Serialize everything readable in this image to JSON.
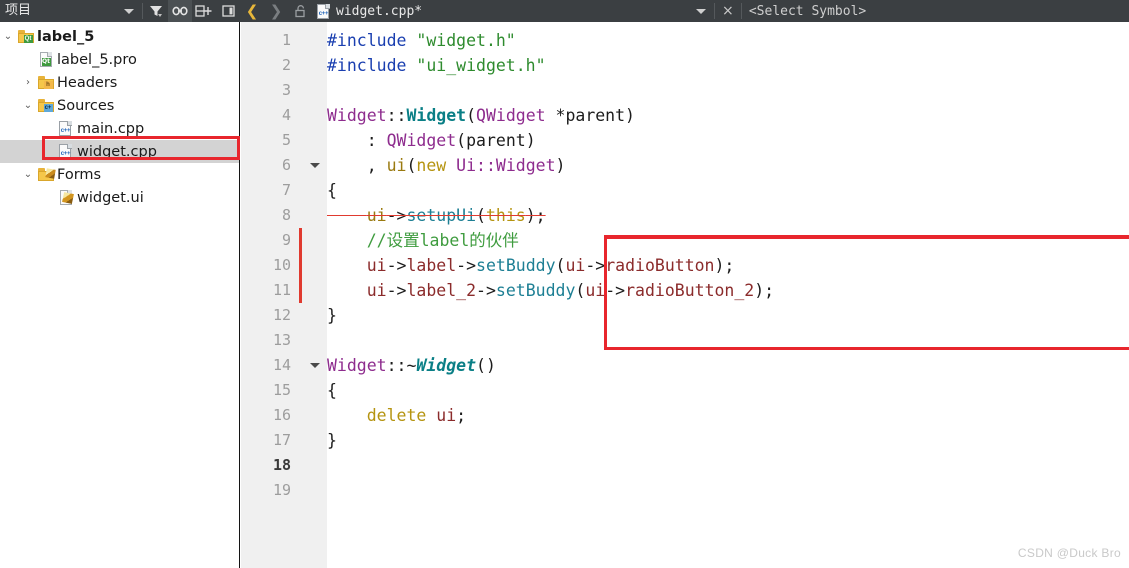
{
  "toolbar": {
    "panel_title": "项目",
    "dropdown_icon": "chevron-down-icon",
    "filter_icon": "filter-icon",
    "link_icon": "link-icon",
    "split_icon": "split-pane-add-icon",
    "sidebar_icon": "sidebar-toggle-icon",
    "back_icon": "back-arrow-icon",
    "forward_icon": "forward-arrow-icon",
    "lock_icon": "unlocked-padlock-icon",
    "file_icon": "cpp-file-icon",
    "file_icon_label": "c++",
    "file_name": "widget.cpp*",
    "file_dropdown_icon": "chevron-down-icon",
    "close_icon": "close-x-icon",
    "close_label": "×",
    "symbol_selector": "<Select Symbol>"
  },
  "tree": {
    "items": [
      {
        "label": "label_5",
        "icon": "qt-project-folder-icon",
        "expander": "⌄",
        "indent": 0,
        "bold": true,
        "selected": false,
        "kind": "folder-qt"
      },
      {
        "label": "label_5.pro",
        "icon": "qt-pro-file-icon",
        "expander": "",
        "indent": 1,
        "bold": false,
        "selected": false,
        "kind": "doc-qt"
      },
      {
        "label": "Headers",
        "icon": "headers-folder-icon",
        "expander": "›",
        "indent": 1,
        "bold": false,
        "selected": false,
        "kind": "folder-h"
      },
      {
        "label": "Sources",
        "icon": "sources-folder-icon",
        "expander": "⌄",
        "indent": 1,
        "bold": false,
        "selected": false,
        "kind": "folder-cpp"
      },
      {
        "label": "main.cpp",
        "icon": "cpp-file-icon",
        "expander": "",
        "indent": 2,
        "bold": false,
        "selected": false,
        "kind": "cppfile"
      },
      {
        "label": "widget.cpp",
        "icon": "cpp-file-icon",
        "expander": "",
        "indent": 2,
        "bold": false,
        "selected": true,
        "kind": "cppfile"
      },
      {
        "label": "Forms",
        "icon": "forms-folder-icon",
        "expander": "⌄",
        "indent": 1,
        "bold": false,
        "selected": false,
        "kind": "folder-ui"
      },
      {
        "label": "widget.ui",
        "icon": "ui-file-icon",
        "expander": "",
        "indent": 2,
        "bold": false,
        "selected": false,
        "kind": "doc-ui"
      }
    ]
  },
  "editor": {
    "current_line": 18,
    "fold_marker_lines": [
      6,
      14
    ],
    "change_bar_lines": [
      9,
      10,
      11
    ],
    "lines": [
      {
        "n": 1,
        "tokens": [
          {
            "t": "#include ",
            "c": "t-pp"
          },
          {
            "t": "\"widget.h\"",
            "c": "t-str"
          }
        ]
      },
      {
        "n": 2,
        "tokens": [
          {
            "t": "#include ",
            "c": "t-pp"
          },
          {
            "t": "\"ui_widget.h\"",
            "c": "t-str"
          }
        ]
      },
      {
        "n": 3,
        "tokens": []
      },
      {
        "n": 4,
        "tokens": [
          {
            "t": "Widget",
            "c": "t-cls"
          },
          {
            "t": "::",
            "c": "t-plain"
          },
          {
            "t": "Widget",
            "c": "t-ctor"
          },
          {
            "t": "(",
            "c": "t-plain"
          },
          {
            "t": "QWidget",
            "c": "t-cls"
          },
          {
            "t": " *parent)",
            "c": "t-plain"
          }
        ]
      },
      {
        "n": 5,
        "tokens": [
          {
            "t": "    : ",
            "c": "t-plain"
          },
          {
            "t": "QWidget",
            "c": "t-cls"
          },
          {
            "t": "(parent)",
            "c": "t-plain"
          }
        ]
      },
      {
        "n": 6,
        "tokens": [
          {
            "t": "    , ",
            "c": "t-plain"
          },
          {
            "t": "ui",
            "c": "t-var"
          },
          {
            "t": "(",
            "c": "t-plain"
          },
          {
            "t": "new",
            "c": "t-kw"
          },
          {
            "t": " ",
            "c": "t-plain"
          },
          {
            "t": "Ui::Widget",
            "c": "t-cls"
          },
          {
            "t": ")",
            "c": "t-plain"
          }
        ]
      },
      {
        "n": 7,
        "tokens": [
          {
            "t": "{",
            "c": "t-plain"
          }
        ]
      },
      {
        "n": 8,
        "tokens": [
          {
            "t": "    ",
            "c": "t-plain"
          },
          {
            "t": "ui",
            "c": "t-var"
          },
          {
            "t": "->",
            "c": "t-plain"
          },
          {
            "t": "setupUi",
            "c": "t-fn"
          },
          {
            "t": "(",
            "c": "t-plain"
          },
          {
            "t": "this",
            "c": "t-kw"
          },
          {
            "t": ");",
            "c": "t-plain"
          }
        ]
      },
      {
        "n": 9,
        "tokens": [
          {
            "t": "    //设置label的伙伴",
            "c": "t-cmt"
          }
        ]
      },
      {
        "n": 10,
        "tokens": [
          {
            "t": "    ",
            "c": "t-plain"
          },
          {
            "t": "ui",
            "c": "t-fld"
          },
          {
            "t": "->",
            "c": "t-plain"
          },
          {
            "t": "label",
            "c": "t-fld"
          },
          {
            "t": "->",
            "c": "t-plain"
          },
          {
            "t": "setBuddy",
            "c": "t-fn"
          },
          {
            "t": "(",
            "c": "t-plain"
          },
          {
            "t": "ui",
            "c": "t-fld"
          },
          {
            "t": "->",
            "c": "t-plain"
          },
          {
            "t": "radioButton",
            "c": "t-fld"
          },
          {
            "t": ");",
            "c": "t-plain"
          }
        ]
      },
      {
        "n": 11,
        "tokens": [
          {
            "t": "    ",
            "c": "t-plain"
          },
          {
            "t": "ui",
            "c": "t-fld"
          },
          {
            "t": "->",
            "c": "t-plain"
          },
          {
            "t": "label_2",
            "c": "t-fld"
          },
          {
            "t": "->",
            "c": "t-plain"
          },
          {
            "t": "setBuddy",
            "c": "t-fn"
          },
          {
            "t": "(",
            "c": "t-plain"
          },
          {
            "t": "ui",
            "c": "t-fld"
          },
          {
            "t": "->",
            "c": "t-plain"
          },
          {
            "t": "radioButton_2",
            "c": "t-fld"
          },
          {
            "t": ");",
            "c": "t-plain"
          }
        ]
      },
      {
        "n": 12,
        "tokens": [
          {
            "t": "}",
            "c": "t-plain"
          }
        ]
      },
      {
        "n": 13,
        "tokens": []
      },
      {
        "n": 14,
        "tokens": [
          {
            "t": "Widget",
            "c": "t-cls"
          },
          {
            "t": "::~",
            "c": "t-plain"
          },
          {
            "t": "Widget",
            "c": "t-dtor"
          },
          {
            "t": "()",
            "c": "t-plain"
          }
        ]
      },
      {
        "n": 15,
        "tokens": [
          {
            "t": "{",
            "c": "t-plain"
          }
        ]
      },
      {
        "n": 16,
        "tokens": [
          {
            "t": "    ",
            "c": "t-plain"
          },
          {
            "t": "delete",
            "c": "t-kw"
          },
          {
            "t": " ",
            "c": "t-plain"
          },
          {
            "t": "ui",
            "c": "t-fld"
          },
          {
            "t": ";",
            "c": "t-plain"
          }
        ]
      },
      {
        "n": 17,
        "tokens": [
          {
            "t": "}",
            "c": "t-plain"
          }
        ]
      },
      {
        "n": 18,
        "tokens": []
      },
      {
        "n": 19,
        "tokens": []
      }
    ]
  },
  "annotations": {
    "tree_highlight_color": "#e8262d",
    "code_highlight_color": "#e8262d",
    "strikethrough_color": "#e03a2f"
  },
  "watermark": "CSDN @Duck Bro"
}
